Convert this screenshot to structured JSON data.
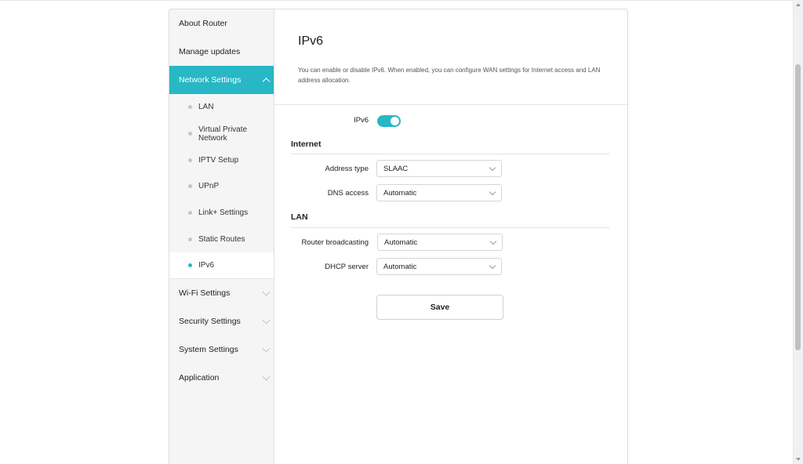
{
  "sidebar": {
    "top_items": [
      {
        "label": "About Router"
      },
      {
        "label": "Manage updates"
      }
    ],
    "network": {
      "label": "Network Settings",
      "items": [
        {
          "label": "LAN"
        },
        {
          "label": "Virtual Private Network"
        },
        {
          "label": "IPTV Setup"
        },
        {
          "label": "UPnP"
        },
        {
          "label": "Link+ Settings"
        },
        {
          "label": "Static Routes"
        },
        {
          "label": "IPv6"
        }
      ]
    },
    "bottom_items": [
      {
        "label": "Wi-Fi Settings"
      },
      {
        "label": "Security Settings"
      },
      {
        "label": "System Settings"
      },
      {
        "label": "Application"
      }
    ]
  },
  "page": {
    "title": "IPv6",
    "description": "You can enable or disable IPv6. When enabled, you can configure WAN settings for Internet access and LAN address allocation."
  },
  "form": {
    "ipv6_label": "IPv6",
    "ipv6_enabled": true,
    "internet": {
      "title": "Internet",
      "address_type_label": "Address type",
      "address_type_value": "SLAAC",
      "dns_access_label": "DNS access",
      "dns_access_value": "Automatic"
    },
    "lan": {
      "title": "LAN",
      "router_broadcasting_label": "Router broadcasting",
      "router_broadcasting_value": "Automatic",
      "dhcp_server_label": "DHCP server",
      "dhcp_server_value": "Automatic"
    },
    "save_label": "Save"
  },
  "colors": {
    "accent": "#27b7c5"
  }
}
